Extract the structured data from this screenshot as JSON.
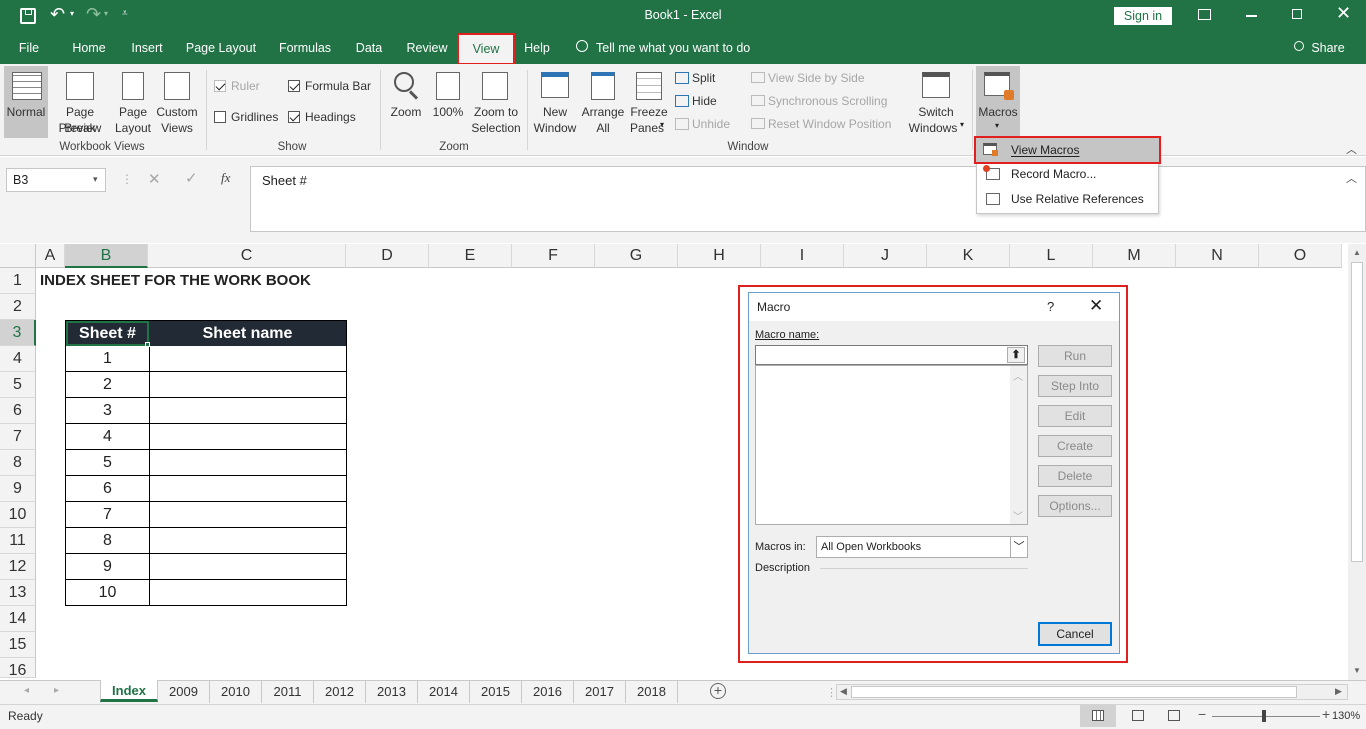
{
  "window": {
    "title": "Book1  -  Excel",
    "sign_in": "Sign in",
    "share": "Share"
  },
  "tabs": [
    "File",
    "Home",
    "Insert",
    "Page Layout",
    "Formulas",
    "Data",
    "Review",
    "View",
    "Help"
  ],
  "tell_me": "Tell me what you want to do",
  "ribbon": {
    "workbook_views": {
      "label": "Workbook Views",
      "normal": "Normal",
      "page_break": [
        "Page Break",
        "Preview"
      ],
      "page_layout": [
        "Page",
        "Layout"
      ],
      "custom_views": [
        "Custom",
        "Views"
      ]
    },
    "show": {
      "label": "Show",
      "ruler": "Ruler",
      "formula_bar": "Formula Bar",
      "gridlines": "Gridlines",
      "headings": "Headings"
    },
    "zoom": {
      "label": "Zoom",
      "zoom": "Zoom",
      "hundred": "100%",
      "zoom_sel": [
        "Zoom to",
        "Selection"
      ]
    },
    "window": {
      "label": "Window",
      "new_window": [
        "New",
        "Window"
      ],
      "arrange_all": [
        "Arrange",
        "All"
      ],
      "freeze": [
        "Freeze",
        "Panes"
      ],
      "split": "Split",
      "hide": "Hide",
      "unhide": "Unhide",
      "side_by_side": "View Side by Side",
      "sync_scroll": "Synchronous Scrolling",
      "reset_pos": "Reset Window Position",
      "switch": [
        "Switch",
        "Windows"
      ]
    },
    "macros": "Macros"
  },
  "macro_menu": [
    "View Macros",
    "Record Macro...",
    "Use Relative References"
  ],
  "formula": {
    "name_box": "B3",
    "fx": "fx",
    "value": "Sheet #"
  },
  "columns": [
    "A",
    "B",
    "C",
    "D",
    "E",
    "F",
    "G",
    "H",
    "I",
    "J",
    "K",
    "L",
    "M",
    "N",
    "O"
  ],
  "rows": [
    "1",
    "2",
    "3",
    "4",
    "5",
    "6",
    "7",
    "8",
    "9",
    "10",
    "11",
    "12",
    "13",
    "14",
    "15",
    "16"
  ],
  "sheet": {
    "title": "INDEX SHEET FOR THE WORK BOOK",
    "header_num": "Sheet #",
    "header_name": "Sheet name",
    "numbers": [
      "1",
      "2",
      "3",
      "4",
      "5",
      "6",
      "7",
      "8",
      "9",
      "10"
    ]
  },
  "sheet_tabs": [
    "Index",
    "2009",
    "2010",
    "2011",
    "2012",
    "2013",
    "2014",
    "2015",
    "2016",
    "2017",
    "2018"
  ],
  "status": {
    "ready": "Ready",
    "zoom": "130%"
  },
  "dialog": {
    "title": "Macro",
    "help": "?",
    "macro_name_label": "Macro name:",
    "buttons": [
      "Run",
      "Step Into",
      "Edit",
      "Create",
      "Delete",
      "Options..."
    ],
    "macros_in_label": "Macros in:",
    "macros_in_value": "All Open Workbooks",
    "description": "Description",
    "cancel": "Cancel"
  },
  "colors": {
    "excel_green": "#217346",
    "highlight_red": "#e0201f",
    "header_dark": "#222a35"
  }
}
